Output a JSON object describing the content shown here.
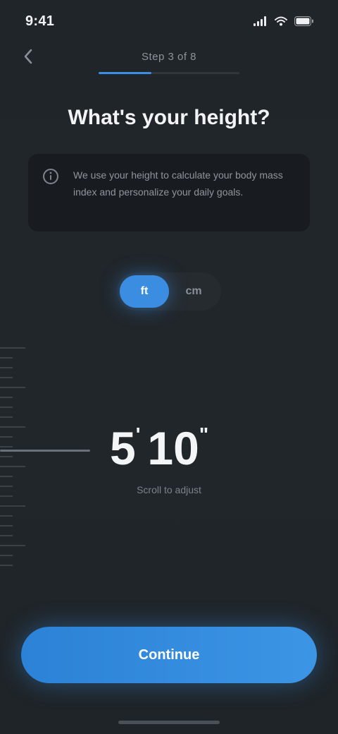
{
  "status_bar": {
    "time": "9:41",
    "icons": [
      "signal-icon",
      "wifi-icon",
      "battery-icon"
    ]
  },
  "header": {
    "back_icon": "chevron-left-icon",
    "step_label": "Step 3 of 8",
    "progress_percent": 37.5
  },
  "title": "What's your height?",
  "info_card": {
    "icon": "info-icon",
    "text": "We use your height to calculate your body mass index and personalize your daily goals."
  },
  "unit_toggle": {
    "options": [
      "ft",
      "cm"
    ],
    "selected": "ft"
  },
  "picker": {
    "feet": "5",
    "feet_unit": "'",
    "inches": "10",
    "inches_unit": "\"",
    "caption": "Scroll to adjust"
  },
  "continue_label": "Continue",
  "colors": {
    "background": "#20252a",
    "accent": "#3a8de0",
    "card": "#181c20",
    "text_primary": "#f2f3f5",
    "text_secondary": "#8f959c"
  }
}
